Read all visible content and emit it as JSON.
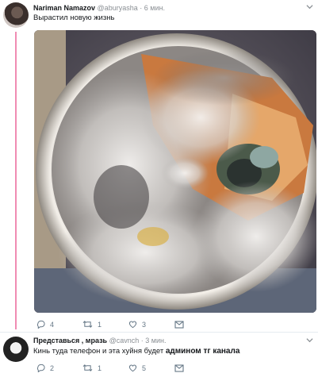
{
  "tweet1": {
    "name": "Nariman Namazov",
    "handle": "@aburyasha",
    "dot": "·",
    "time": "6 мин.",
    "text": "Вырастил новую жизнь",
    "replies": "4",
    "retweets": "1",
    "likes": "3"
  },
  "tweet2": {
    "name": "Представься , мразь",
    "handle": "@cavnch",
    "dot": "·",
    "time": "3 мин.",
    "text_plain": "Кинь туда телефон и эта хуйня будет",
    "text_bold": "админом тг канала",
    "replies": "2",
    "retweets": "1",
    "likes": "5"
  },
  "icons": {
    "reply": "reply-icon",
    "retweet": "retweet-icon",
    "like": "heart-icon",
    "message": "direct-message-icon",
    "menu": "chevron-down-icon"
  },
  "colors": {
    "thread_line": "#f08cb3",
    "muted": "#8a8f94",
    "text": "#14171a"
  }
}
